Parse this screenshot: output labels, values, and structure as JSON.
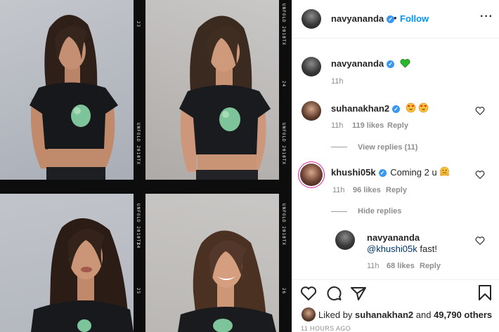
{
  "post": {
    "author": "navyananda",
    "follow_label": "Follow",
    "caption_emoji": "green-heart",
    "caption_time": "11h",
    "film_labels": [
      "UNFOLD 2010TX",
      "24",
      "23",
      "25",
      "26"
    ]
  },
  "comments": [
    {
      "user": "suhanakhan2",
      "text": "",
      "emoji": [
        "heart-eyes",
        "heart-eyes"
      ],
      "time": "11h",
      "likes": "119 likes",
      "reply": "Reply",
      "thread": "View replies (11)"
    },
    {
      "user": "khushi05k",
      "text": "Coming 2 u",
      "emoji": [
        "hugging"
      ],
      "time": "11h",
      "likes": "96 likes",
      "reply": "Reply",
      "thread": "Hide replies"
    }
  ],
  "reply": {
    "user": "navyananda",
    "mention": "@khushi05k",
    "text": " fast!",
    "time": "11h",
    "likes": "68 likes",
    "reply": "Reply"
  },
  "footer": {
    "liked_prefix": "Liked by ",
    "liked_user": "suhanakhan2",
    "liked_mid": " and ",
    "liked_count": "49,790 others",
    "timestamp": "11 HOURS AGO"
  },
  "colors": {
    "accent": "#0095f6",
    "verified": "#3897f0",
    "muted": "#8e8e8e"
  }
}
